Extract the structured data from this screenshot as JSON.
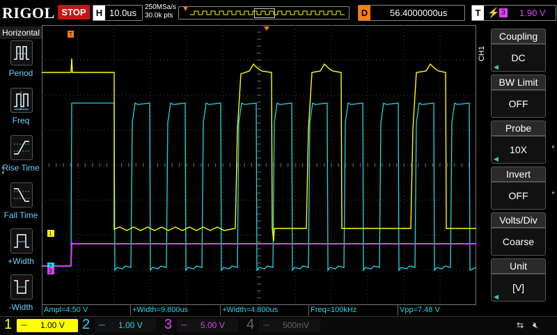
{
  "header": {
    "brand": "RIGOL",
    "run_state": "STOP",
    "timebase_label": "H",
    "timebase": "10.0us",
    "sample_rate": "250MSa/s",
    "memory_depth": "30.0k pts",
    "delay_label": "D",
    "delay": "56.4000000us",
    "trigger_label": "T",
    "trigger_source": "3",
    "trigger_level": "1.90 V"
  },
  "left_menu": {
    "title": "Horizontal",
    "items": [
      {
        "label": "Period",
        "icon": "period-icon"
      },
      {
        "label": "Freq",
        "icon": "frequency-icon"
      },
      {
        "label": "Rise Time",
        "icon": "rise-time-icon"
      },
      {
        "label": "Fall Time",
        "icon": "fall-time-icon"
      },
      {
        "label": "+Width",
        "icon": "positive-width-icon"
      },
      {
        "label": "-Width",
        "icon": "negative-width-icon"
      }
    ]
  },
  "right_menu": {
    "channel": "CH1",
    "items": [
      {
        "title": "Coupling",
        "value": "DC",
        "arrow": true
      },
      {
        "title": "BW Limit",
        "value": "OFF",
        "arrow": false
      },
      {
        "title": "Probe",
        "value": "10X",
        "arrow": true
      },
      {
        "title": "Invert",
        "value": "OFF",
        "arrow": false
      },
      {
        "title": "Volts/Div",
        "value": "Coarse",
        "arrow": false
      },
      {
        "title": "Unit",
        "value": "[V]",
        "arrow": true
      }
    ]
  },
  "measurements": [
    {
      "text": "Ampl=4.50 V",
      "color": "#22d8e8"
    },
    {
      "text": "+Width=9.800us",
      "color": "#22d8e8"
    },
    {
      "text": "+Width=4.800us",
      "color": "#22d8e8"
    },
    {
      "text": "Freq=100kHz",
      "color": "#22d8e8"
    },
    {
      "text": "Vpp=7.48 V",
      "color": "#22d8e8"
    }
  ],
  "channels": [
    {
      "num": "1",
      "scale": "1.00 V",
      "color": "#ffff00",
      "active": true
    },
    {
      "num": "2",
      "scale": "1.00 V",
      "color": "#22d8e8",
      "active": false
    },
    {
      "num": "3",
      "scale": "5.00 V",
      "color": "#e040ff",
      "active": false
    },
    {
      "num": "4",
      "scale": "500mV",
      "color": "#4060ff",
      "active": false
    }
  ],
  "markers": {
    "ch1": "1",
    "ch2": "2",
    "ch3": "3",
    "trigger_level_marker": "T"
  },
  "colors": {
    "ch1": "#ffff00",
    "ch2": "#22d8e8",
    "ch3": "#e040ff",
    "trigger": "#ff7f00",
    "grid": "#4a4a4a"
  },
  "icons": {
    "usb": "usb-icon",
    "speaker": "speaker-muted-icon"
  }
}
